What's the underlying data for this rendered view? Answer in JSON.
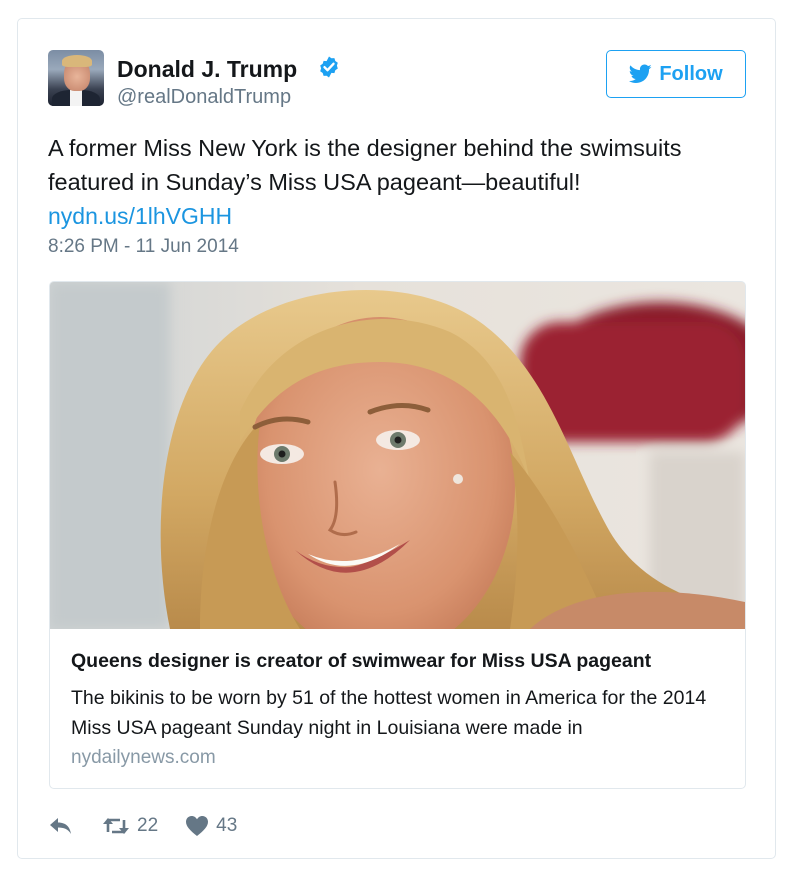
{
  "user": {
    "name": "Donald J. Trump",
    "handle": "@realDonaldTrump",
    "verified": true
  },
  "follow_button": {
    "label": "Follow",
    "icon": "twitter-bird-icon",
    "color": "#1da1f2"
  },
  "tweet": {
    "text": "A former Miss New York is the designer behind the swimsuits featured in Sunday’s Miss USA pageant—beautiful!",
    "link": "nydn.us/1lhVGHH",
    "timestamp": "8:26 PM - 11 Jun 2014"
  },
  "card": {
    "title": "Queens designer is creator of swimwear for Miss USA pageant",
    "description": "The bikinis to be worn by 51 of the hottest women in America for the 2014 Miss USA pageant Sunday night in Louisiana were made in",
    "domain": "nydailynews.com"
  },
  "actions": {
    "reply_icon": "reply-icon",
    "retweet_icon": "retweet-icon",
    "retweets": "22",
    "like_icon": "heart-icon",
    "likes": "43"
  },
  "colors": {
    "link": "#1b95e0",
    "muted": "#657786",
    "border": "#e1e8ed"
  }
}
